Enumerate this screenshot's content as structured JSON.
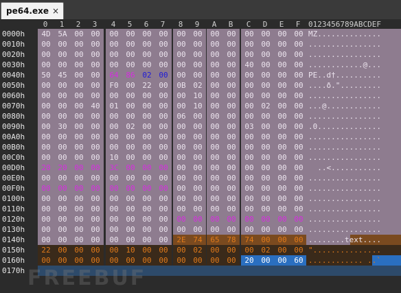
{
  "tab": {
    "title": "pe64.exe",
    "close_glyph": "×"
  },
  "columns": [
    "0",
    "1",
    "2",
    "3",
    "4",
    "5",
    "6",
    "7",
    "8",
    "9",
    "A",
    "B",
    "C",
    "D",
    "E",
    "F"
  ],
  "ascii_header": "0123456789ABCDEF",
  "colors": {
    "default_bg": "#8e7c8f",
    "default_fg": "#ece4ee",
    "magenta": "#d62ee0",
    "blue": "#1e1ad8",
    "orange": "#e07a1a",
    "orange_bg": "#7a4a1f",
    "selection_bg": "#2a6fc0",
    "empty_bg": "#2d4a6a"
  },
  "rows": [
    {
      "offset": "0000h",
      "bytes": [
        "4D",
        "5A",
        "00",
        "00",
        "00",
        "00",
        "00",
        "00",
        "00",
        "00",
        "00",
        "00",
        "00",
        "00",
        "00",
        "00"
      ],
      "ascii": "MZ.............."
    },
    {
      "offset": "0010h",
      "bytes": [
        "00",
        "00",
        "00",
        "00",
        "00",
        "00",
        "00",
        "00",
        "00",
        "00",
        "00",
        "00",
        "00",
        "00",
        "00",
        "00"
      ],
      "ascii": "................"
    },
    {
      "offset": "0020h",
      "bytes": [
        "00",
        "00",
        "00",
        "00",
        "00",
        "00",
        "00",
        "00",
        "00",
        "00",
        "00",
        "00",
        "00",
        "00",
        "00",
        "00"
      ],
      "ascii": "................"
    },
    {
      "offset": "0030h",
      "bytes": [
        "00",
        "00",
        "00",
        "00",
        "00",
        "00",
        "00",
        "00",
        "00",
        "00",
        "00",
        "00",
        "40",
        "00",
        "00",
        "00"
      ],
      "ascii": "............@..."
    },
    {
      "offset": "0040h",
      "bytes": [
        "50",
        "45",
        "00",
        "00",
        "64",
        "86",
        "02",
        "00",
        "00",
        "00",
        "00",
        "00",
        "00",
        "00",
        "00",
        "00"
      ],
      "ascii": "PE..d†..........",
      "colored": {
        "4": "magenta",
        "5": "magenta",
        "6": "blue",
        "7": "blue"
      }
    },
    {
      "offset": "0050h",
      "bytes": [
        "00",
        "00",
        "00",
        "00",
        "F0",
        "00",
        "22",
        "00",
        "0B",
        "02",
        "00",
        "00",
        "00",
        "00",
        "00",
        "00"
      ],
      "ascii": "....ð.\"........."
    },
    {
      "offset": "0060h",
      "bytes": [
        "00",
        "00",
        "00",
        "00",
        "00",
        "00",
        "00",
        "00",
        "00",
        "10",
        "00",
        "00",
        "00",
        "00",
        "00",
        "00"
      ],
      "ascii": "................"
    },
    {
      "offset": "0070h",
      "bytes": [
        "00",
        "00",
        "00",
        "40",
        "01",
        "00",
        "00",
        "00",
        "00",
        "10",
        "00",
        "00",
        "00",
        "02",
        "00",
        "00"
      ],
      "ascii": "...@............"
    },
    {
      "offset": "0080h",
      "bytes": [
        "00",
        "00",
        "00",
        "00",
        "00",
        "00",
        "00",
        "00",
        "06",
        "00",
        "00",
        "00",
        "00",
        "00",
        "00",
        "00"
      ],
      "ascii": "................"
    },
    {
      "offset": "0090h",
      "bytes": [
        "00",
        "30",
        "00",
        "00",
        "00",
        "02",
        "00",
        "00",
        "00",
        "00",
        "00",
        "00",
        "03",
        "00",
        "00",
        "00"
      ],
      "ascii": ".0.............."
    },
    {
      "offset": "00A0h",
      "bytes": [
        "00",
        "00",
        "00",
        "00",
        "00",
        "00",
        "00",
        "00",
        "00",
        "00",
        "00",
        "00",
        "00",
        "00",
        "00",
        "00"
      ],
      "ascii": "................"
    },
    {
      "offset": "00B0h",
      "bytes": [
        "00",
        "00",
        "00",
        "00",
        "00",
        "00",
        "00",
        "00",
        "00",
        "00",
        "00",
        "00",
        "00",
        "00",
        "00",
        "00"
      ],
      "ascii": "................"
    },
    {
      "offset": "00C0h",
      "bytes": [
        "00",
        "00",
        "00",
        "00",
        "10",
        "00",
        "00",
        "00",
        "00",
        "00",
        "00",
        "00",
        "00",
        "00",
        "00",
        "00"
      ],
      "ascii": "................"
    },
    {
      "offset": "00D0h",
      "bytes": [
        "20",
        "20",
        "00",
        "00",
        "3C",
        "00",
        "00",
        "00",
        "00",
        "00",
        "00",
        "00",
        "00",
        "00",
        "00",
        "00"
      ],
      "ascii": "  ..<...........",
      "colored": {
        "0": "magenta",
        "1": "magenta",
        "2": "magenta",
        "3": "magenta",
        "4": "magenta",
        "5": "magenta",
        "6": "magenta",
        "7": "magenta"
      }
    },
    {
      "offset": "00E0h",
      "bytes": [
        "00",
        "00",
        "00",
        "00",
        "00",
        "00",
        "00",
        "00",
        "00",
        "00",
        "00",
        "00",
        "00",
        "00",
        "00",
        "00"
      ],
      "ascii": "................"
    },
    {
      "offset": "00F0h",
      "bytes": [
        "00",
        "00",
        "00",
        "00",
        "00",
        "00",
        "00",
        "00",
        "00",
        "00",
        "00",
        "00",
        "00",
        "00",
        "00",
        "00"
      ],
      "ascii": "................",
      "colored": {
        "0": "magenta",
        "1": "magenta",
        "2": "magenta",
        "3": "magenta",
        "4": "magenta",
        "5": "magenta",
        "6": "magenta",
        "7": "magenta"
      }
    },
    {
      "offset": "0100h",
      "bytes": [
        "00",
        "00",
        "00",
        "00",
        "00",
        "00",
        "00",
        "00",
        "00",
        "00",
        "00",
        "00",
        "00",
        "00",
        "00",
        "00"
      ],
      "ascii": "................"
    },
    {
      "offset": "0110h",
      "bytes": [
        "00",
        "00",
        "00",
        "00",
        "00",
        "00",
        "00",
        "00",
        "00",
        "00",
        "00",
        "00",
        "00",
        "00",
        "00",
        "00"
      ],
      "ascii": "................"
    },
    {
      "offset": "0120h",
      "bytes": [
        "00",
        "00",
        "00",
        "00",
        "00",
        "00",
        "00",
        "00",
        "00",
        "00",
        "00",
        "00",
        "00",
        "00",
        "00",
        "00"
      ],
      "ascii": "................",
      "colored": {
        "8": "magenta",
        "9": "magenta",
        "10": "magenta",
        "11": "magenta",
        "12": "magenta",
        "13": "magenta",
        "14": "magenta",
        "15": "magenta"
      }
    },
    {
      "offset": "0130h",
      "bytes": [
        "00",
        "00",
        "00",
        "00",
        "00",
        "00",
        "00",
        "00",
        "00",
        "00",
        "00",
        "00",
        "00",
        "00",
        "00",
        "00"
      ],
      "ascii": "................"
    },
    {
      "offset": "0140h",
      "bytes": [
        "00",
        "00",
        "00",
        "00",
        "00",
        "00",
        "00",
        "00",
        "2E",
        "74",
        "65",
        "78",
        "74",
        "00",
        "00",
        "00"
      ],
      "ascii": "........text....",
      "orange": [
        8,
        9,
        10,
        11,
        12,
        13,
        14,
        15
      ]
    },
    {
      "offset": "0150h",
      "bytes": [
        "22",
        "00",
        "00",
        "00",
        "00",
        "10",
        "00",
        "00",
        "00",
        "02",
        "00",
        "00",
        "00",
        "02",
        "00",
        "00"
      ],
      "ascii": "\"...............",
      "orange_fg": [
        0,
        1,
        2,
        3,
        4,
        5,
        6,
        7,
        8,
        9,
        10,
        11,
        12,
        13,
        14,
        15
      ]
    },
    {
      "offset": "0160h",
      "bytes": [
        "00",
        "00",
        "00",
        "00",
        "00",
        "00",
        "00",
        "00",
        "00",
        "00",
        "00",
        "00",
        "20",
        "00",
        "00",
        "60"
      ],
      "ascii": "............ ..`",
      "orange_fg": [
        0,
        1,
        2,
        3,
        4,
        5,
        6,
        7,
        8,
        9,
        10,
        11
      ],
      "selected": [
        12,
        13,
        14,
        15
      ]
    },
    {
      "offset": "0170h",
      "bytes": [],
      "ascii": ""
    }
  ],
  "watermark": "FREEBUF"
}
